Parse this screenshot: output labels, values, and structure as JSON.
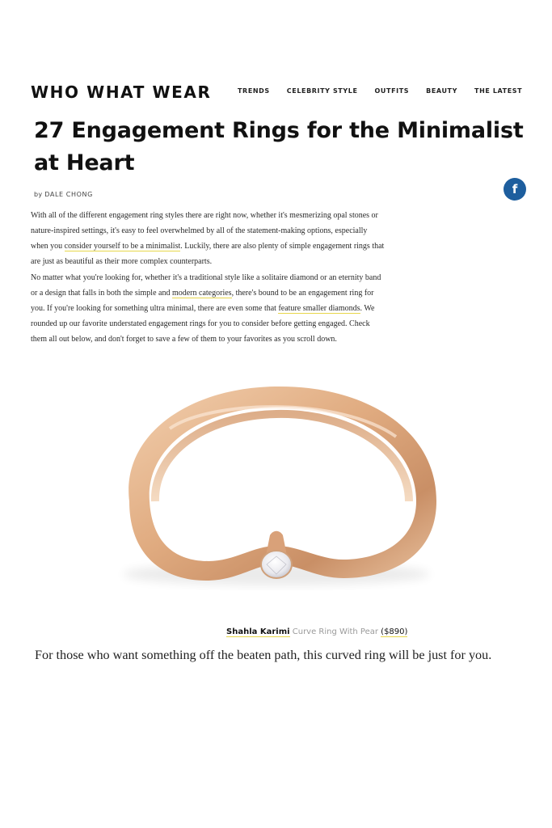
{
  "header": {
    "logo": "WHO WHAT WEAR",
    "nav": [
      "TRENDS",
      "CELEBRITY STYLE",
      "OUTFITS",
      "BEAUTY",
      "THE LATEST"
    ]
  },
  "article": {
    "title": "27 Engagement Rings for the Minimalist at Heart",
    "byline_prefix": "by",
    "author": "DALE CHONG",
    "share_icon_glyph": "f",
    "para1": {
      "t1": "With all of the different engagement ring styles there are right now, whether it's mesmerizing opal stones or nature-inspired settings, it's easy to feel overwhelmed by all of the statement-making options, especially when you ",
      "link1": "consider yourself to be a minimalist",
      "t2": ". Luckily, there are also plenty of simple engagement rings that are just as beautiful as their more complex counterparts."
    },
    "para2": {
      "t1": "No matter what you're looking for, whether it's a traditional style like a solitaire diamond or an eternity band or a design that falls in both the simple and ",
      "link1": "modern categories",
      "t2": ", there's bound to be an engagement ring for you. If you're looking for something ultra minimal, there are even some that ",
      "link2": "feature smaller diamonds",
      "t3": ". We rounded up our favorite understated engagement rings for you to consider before getting engaged. Check them all out below, and don't forget to save a few of them to your favorites as you scroll down."
    },
    "product": {
      "brand": "Shahla Karimi",
      "name": "Curve Ring With Pear",
      "price": "($890)"
    },
    "caption_text": "For those who want something off the beaten path, this curved ring will be just for you."
  },
  "colors": {
    "link_underline": "#e7d64a",
    "facebook_blue": "#1d5e9e",
    "ring_gold": "#e3b48e"
  }
}
